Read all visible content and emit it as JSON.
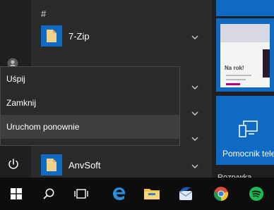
{
  "app_list": {
    "section_hash": "#",
    "items": [
      {
        "label": "7-Zip"
      },
      {
        "label": "AnvSoft"
      }
    ]
  },
  "power_menu": {
    "items": [
      {
        "label": "Uśpij"
      },
      {
        "label": "Zamknij"
      },
      {
        "label": "Uruchom ponownie"
      }
    ]
  },
  "tiles": {
    "promo_text": "Na rok!",
    "help_tile_label": "Pomocnik tele",
    "section_label": "Rozrywka"
  },
  "colors": {
    "accent": "#0f6ac4",
    "menu_bg": "#2b2b2b",
    "menu_hover": "#3e3e3e",
    "taskbar_bg": "#0d0d0d"
  },
  "taskbar": {
    "buttons": [
      "windows-start-icon",
      "search-icon",
      "task-view-icon",
      "edge-icon",
      "file-explorer-icon",
      "thunderbird-icon",
      "chrome-icon",
      "spotify-icon"
    ]
  }
}
